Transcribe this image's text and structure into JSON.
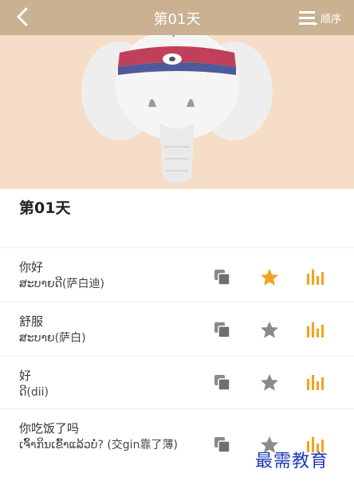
{
  "header": {
    "back_icon": "chevron-left-icon",
    "title": "第01天",
    "order_icon": "menu-lines-icon",
    "order_label": "顺序"
  },
  "hero": {
    "image": "elephant-illustration"
  },
  "day": {
    "title": "第01天"
  },
  "phrases": [
    {
      "chinese": "你好",
      "lao": "ສະບາຍດີ(萨白迪)",
      "favorited": true
    },
    {
      "chinese": "舒服",
      "lao": "ສະບາຍ(萨白)",
      "favorited": false
    },
    {
      "chinese": "好",
      "lao": "ດີ(dii)",
      "favorited": false
    },
    {
      "chinese": "你吃饭了吗",
      "lao": "ເຈົ້າກິນເຂົ້າແລ້ວບໍ່? (交gin靠了薄)",
      "favorited": false
    }
  ],
  "icons": {
    "copy": "copy-icon",
    "star": "star-icon",
    "sound": "sound-bars-icon"
  },
  "colors": {
    "header_bg": "#c9b192",
    "hero_bg": "#f6ddc7",
    "accent_orange": "#f5a11c",
    "icon_gray": "#8a8a8a",
    "watermark_blue": "#1b3bb8"
  },
  "watermark": {
    "text": "最需教育"
  }
}
